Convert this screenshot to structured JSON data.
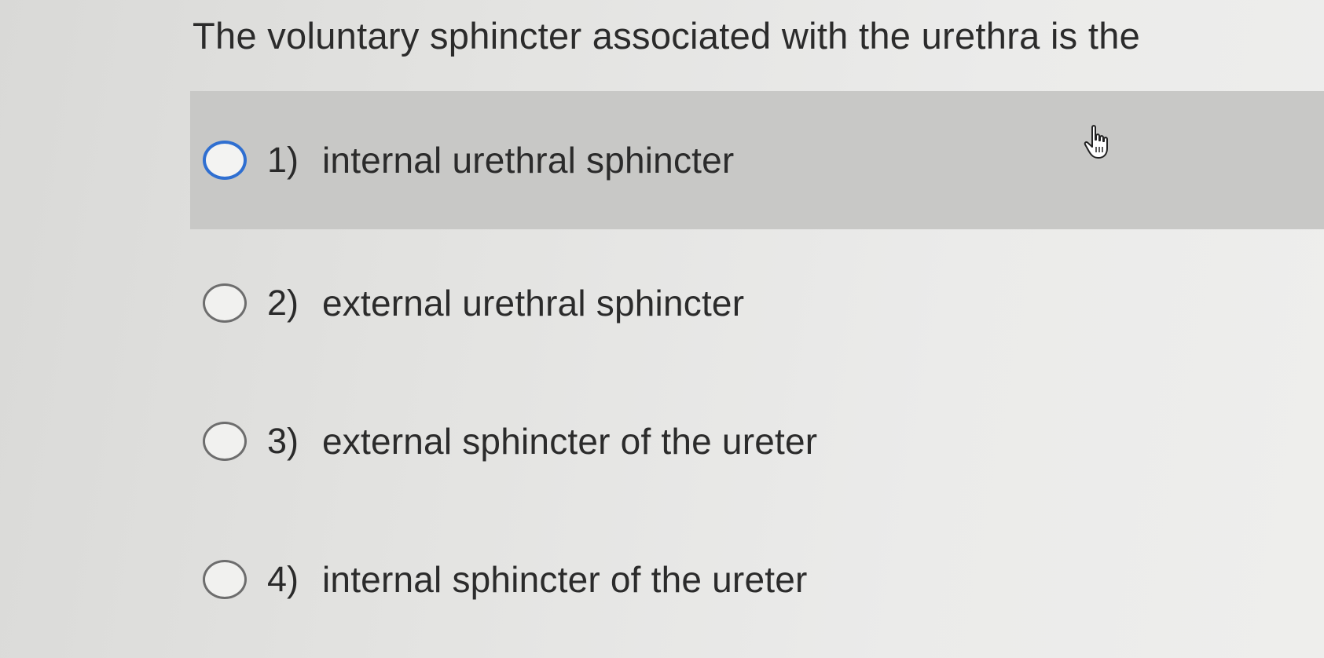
{
  "question": {
    "text": "The voluntary sphincter associated with the urethra is the"
  },
  "options": [
    {
      "number": "1)",
      "label": "internal urethral sphincter",
      "state": "hovered"
    },
    {
      "number": "2)",
      "label": "external urethral sphincter",
      "state": "normal"
    },
    {
      "number": "3)",
      "label": "external sphincter of the ureter",
      "state": "normal"
    },
    {
      "number": "4)",
      "label": "internal sphincter of the ureter",
      "state": "normal"
    }
  ],
  "colors": {
    "hover_background": "#c8c8c6",
    "radio_focus_border": "#2f6fd1",
    "text": "#2b2b2b"
  },
  "icons": {
    "cursor": "hand-pointer-icon"
  }
}
